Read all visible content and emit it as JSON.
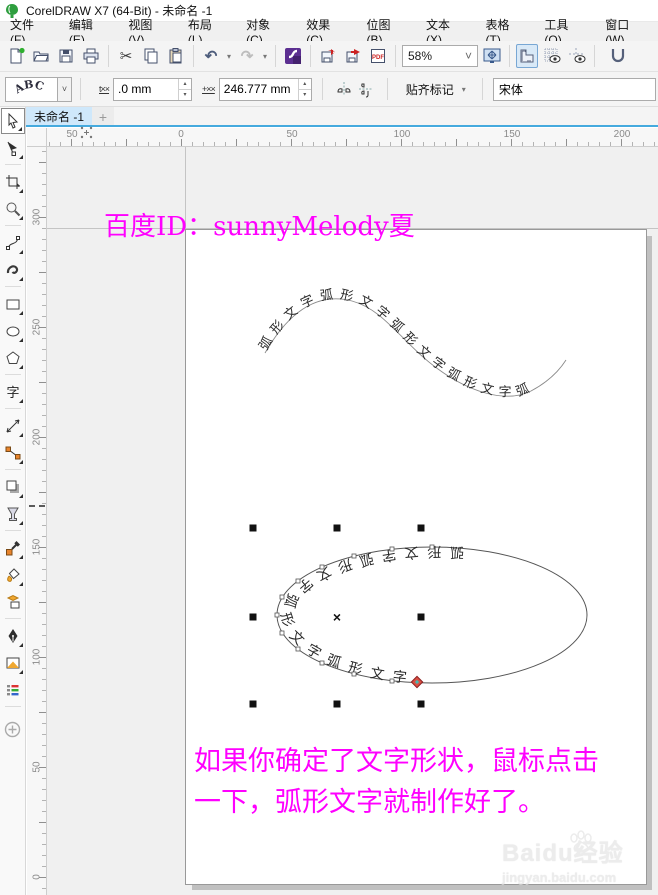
{
  "titlebar": {
    "title": "CorelDRAW X7 (64-Bit) - 未命名 -1"
  },
  "menu": {
    "items": [
      {
        "label": "文件(F)"
      },
      {
        "label": "编辑(E)"
      },
      {
        "label": "视图(V)"
      },
      {
        "label": "布局(L)"
      },
      {
        "label": "对象(C)"
      },
      {
        "label": "效果(C)"
      },
      {
        "label": "位图(B)"
      },
      {
        "label": "文本(X)"
      },
      {
        "label": "表格(T)"
      },
      {
        "label": "工具(O)"
      },
      {
        "label": "窗口(W)"
      }
    ]
  },
  "toolbar": {
    "zoom_level": "58%"
  },
  "icons": {
    "cut": "✂",
    "undo": "↶",
    "redo": "↷",
    "dropdown": "▾",
    "caret_down": "˅",
    "spin_up": "▴",
    "spin_down": "▾",
    "pdf": "PDF",
    "offset": "t××",
    "distance": "+××",
    "abc_preview": "ABC",
    "text_tool": "字",
    "center_mark": "×",
    "new_tab": "+"
  },
  "propbar": {
    "offset_value": ".0 mm",
    "distance_value": "246.777 mm",
    "snap_label": "贴齐标记",
    "font_value": "宋体"
  },
  "tabs": {
    "active": "未命名 -1"
  },
  "rulers": {
    "horizontal": [
      "50",
      "0",
      "50",
      "100",
      "150",
      "200"
    ],
    "vertical": [
      "300",
      "250",
      "200",
      "150",
      "100",
      "50",
      "0"
    ]
  },
  "document": {
    "note_top": "百度ID：sunnyMelody夏",
    "curve_text": "弧形文字弧形文字弧形文字弧形文字弧",
    "ellipse_text": "弧形文字弧形文字弧形文字弧形文字",
    "note_bottom_line1": "如果你确定了文字形状，鼠标点击",
    "note_bottom_line2": "一下，弧形文字就制作好了。"
  },
  "watermark": {
    "title": "Baidu经验",
    "url": "jingyan.baidu.com"
  },
  "colors": {
    "accent": "#ff00ff",
    "tab_underline": "#45aade",
    "handle": "#111111",
    "endnode": "#d94f43",
    "logo_green": "#2e9e3e",
    "launcher_purple": "#5c2f91"
  }
}
